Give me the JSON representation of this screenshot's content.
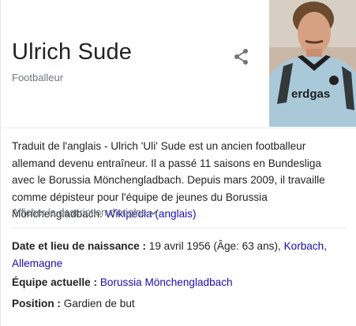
{
  "header": {
    "title": "Ulrich Sude",
    "subtitle": "Footballeur"
  },
  "icons": {
    "share": "share-icon",
    "expand": "chevron-down-icon"
  },
  "photo": {
    "shirt_text": "erdgas",
    "shirt_color": "#a9c9d9",
    "collar_color": "#1e1e1e"
  },
  "description": {
    "text": "Traduit de l'anglais - Ulrich 'Uli' Sude est un ancien footballeur allemand devenu entraîneur. Il a passé 11 saisons en Bundesliga avec le Borussia Mönchengladbach. Depuis mars 2009, il travaille comme dépisteur pour l'équipe de jeunes du Borussia Mönchengladbach.",
    "source_link": "Wikipédia (anglais)"
  },
  "show_original": "Afficher la description d'origine",
  "facts": {
    "birth": {
      "label": "Date et lieu de naissance :",
      "value": "19 avril 1956 (Âge: 63 ans),",
      "place_link": "Korbach,",
      "country_link": "Allemagne"
    },
    "team": {
      "label": "Équipe actuelle :",
      "value_link": "Borussia Mönchengladbach"
    },
    "position": {
      "label": "Position :",
      "value": "Gardien de but"
    }
  },
  "colors": {
    "link": "#1a0dab",
    "muted": "#70757a",
    "text": "#222222"
  }
}
